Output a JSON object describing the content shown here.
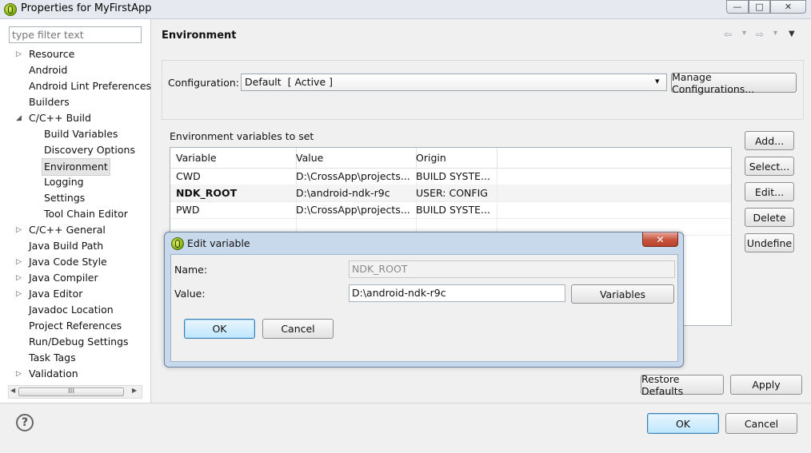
{
  "window": {
    "title": "Properties for MyFirstApp",
    "buttons": {
      "minimize": "—",
      "maximize": "□",
      "close": "✕"
    }
  },
  "sidebar": {
    "filter_placeholder": "type filter text",
    "items": [
      {
        "label": "Resource",
        "expander": "▷"
      },
      {
        "label": "Android",
        "expander": ""
      },
      {
        "label": "Android Lint Preferences",
        "expander": ""
      },
      {
        "label": "Builders",
        "expander": ""
      },
      {
        "label": "C/C++ Build",
        "expander": "◢"
      },
      {
        "label": "Build Variables",
        "expander": ""
      },
      {
        "label": "Discovery Options",
        "expander": ""
      },
      {
        "label": "Environment",
        "expander": ""
      },
      {
        "label": "Logging",
        "expander": ""
      },
      {
        "label": "Settings",
        "expander": ""
      },
      {
        "label": "Tool Chain Editor",
        "expander": ""
      },
      {
        "label": "C/C++ General",
        "expander": "▷"
      },
      {
        "label": "Java Build Path",
        "expander": ""
      },
      {
        "label": "Java Code Style",
        "expander": "▷"
      },
      {
        "label": "Java Compiler",
        "expander": "▷"
      },
      {
        "label": "Java Editor",
        "expander": "▷"
      },
      {
        "label": "Javadoc Location",
        "expander": ""
      },
      {
        "label": "Project References",
        "expander": ""
      },
      {
        "label": "Run/Debug Settings",
        "expander": ""
      },
      {
        "label": "Task Tags",
        "expander": ""
      },
      {
        "label": "Validation",
        "expander": "▷"
      }
    ],
    "scroll_left": "◀",
    "scroll_right": "▶",
    "scroll_grip": "III"
  },
  "page": {
    "title": "Environment",
    "nav": {
      "back": "⇦",
      "back_menu": "▾",
      "forward": "⇨",
      "forward_menu": "▾",
      "view_menu": "▼"
    }
  },
  "config": {
    "label": "Configuration:",
    "selected": "Default  [ Active ]",
    "dropdown_arrow": "▾",
    "manage_label": "Manage Configurations..."
  },
  "env": {
    "label": "Environment variables to set",
    "columns": [
      "Variable",
      "Value",
      "Origin"
    ],
    "rows": [
      {
        "variable": "CWD",
        "value": "D:\\CrossApp\\projects...",
        "origin": "BUILD SYSTE..."
      },
      {
        "variable": "NDK_ROOT",
        "value": "D:\\android-ndk-r9c",
        "origin": "USER: CONFIG"
      },
      {
        "variable": "PWD",
        "value": "D:\\CrossApp\\projects...",
        "origin": "BUILD SYSTE..."
      }
    ],
    "buttons": {
      "add": "Add...",
      "select": "Select...",
      "edit": "Edit...",
      "delete": "Delete",
      "undefine": "Undefine"
    }
  },
  "dialog": {
    "title": "Edit variable",
    "close": "✕",
    "name_label": "Name:",
    "name_value": "NDK_ROOT",
    "value_label": "Value:",
    "value_value": "D:\\android-ndk-r9c",
    "variables_button": "Variables",
    "ok": "OK",
    "cancel": "Cancel"
  },
  "footer": {
    "restore_defaults": "Restore Defaults",
    "apply": "Apply",
    "ok": "OK",
    "cancel": "Cancel",
    "help": "?"
  }
}
